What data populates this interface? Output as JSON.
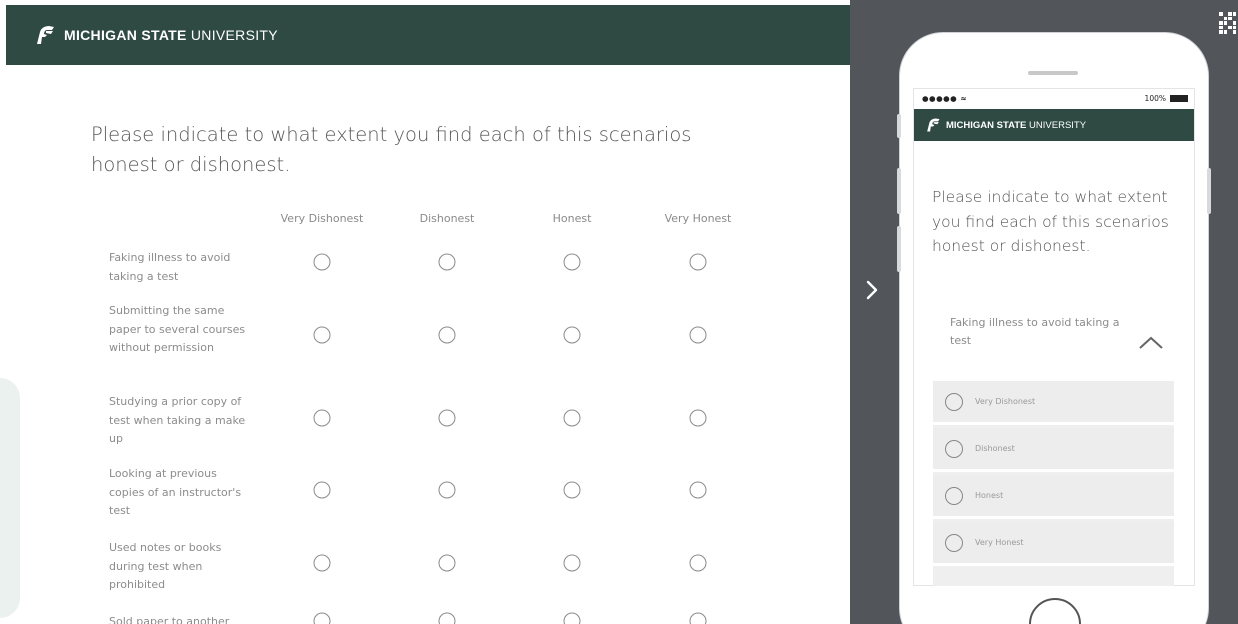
{
  "desktop": {
    "header": {
      "brand_bold": "MICHIGAN STATE",
      "brand_light": " UNIVERSITY",
      "logo_icon": "spartan-helmet-icon"
    },
    "question": "Please indicate to what extent you find each of this scenarios honest or dishonest.",
    "columns": [
      "Very Dishonest",
      "Dishonest",
      "Honest",
      "Very Honest"
    ],
    "rows": [
      "Faking illness to avoid taking a test",
      "Submitting the same paper to several courses without permission",
      "Studying a prior copy of test when taking a make up",
      "Looking at previous copies of an instructor's test",
      "Used notes or books during test when prohibited",
      "Sold paper to another"
    ]
  },
  "panel": {
    "next_icon": "chevron-right-icon",
    "qr_icon": "qr-code-icon"
  },
  "mobile": {
    "status_left": "●●●●● ",
    "status_right": "100%",
    "header": {
      "brand_bold": "MICHIGAN STATE",
      "brand_light": " UNIVERSITY"
    },
    "question": "Please indicate to what extent you find each of this scenarios honest or dishonest.",
    "item_label": "Faking illness to avoid taking a test",
    "options": [
      "Very Dishonest",
      "Dishonest",
      "Honest",
      "Very Honest"
    ]
  },
  "colors": {
    "brand_green": "#2e4a42",
    "panel_gray": "#52555a",
    "text_gray": "#555555"
  }
}
